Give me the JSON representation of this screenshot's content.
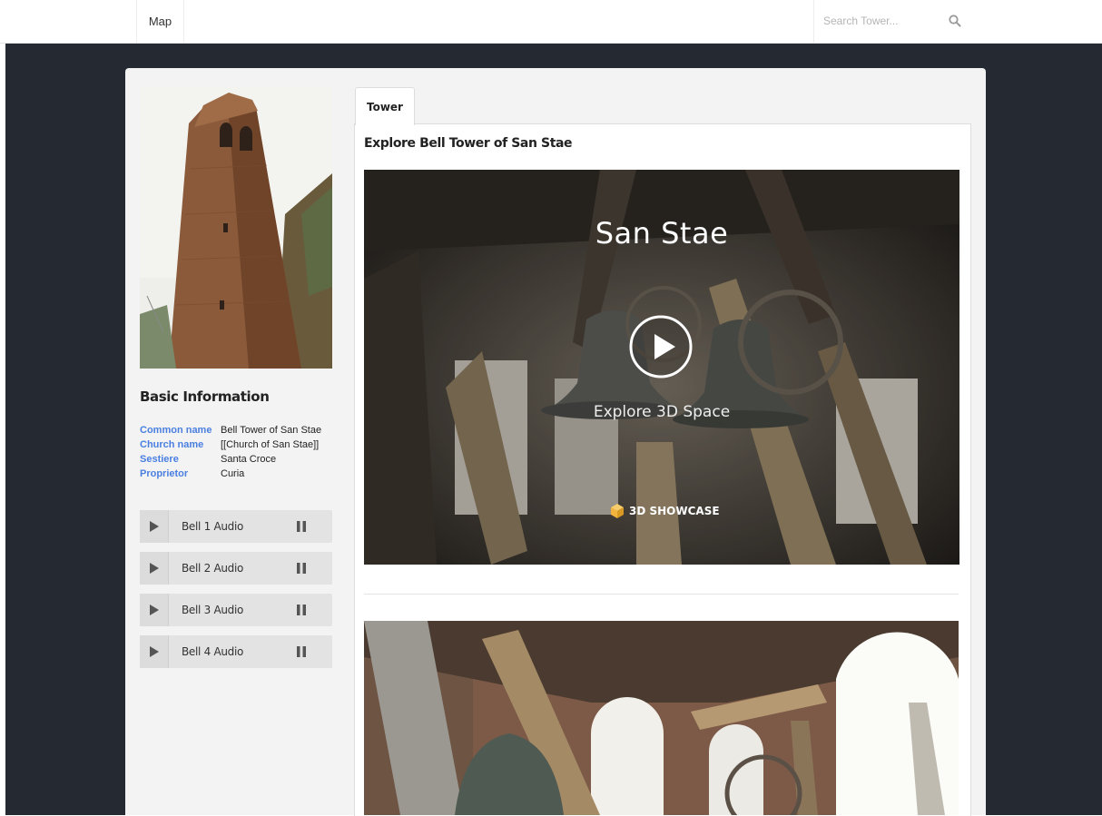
{
  "navbar": {
    "map_link": "Map",
    "search": {
      "placeholder": "Search Tower...",
      "icon": "search-icon"
    }
  },
  "sidebar": {
    "photo_icon": "tower-photo",
    "basic_info": {
      "heading": "Basic Information",
      "rows": [
        {
          "key": "Common name",
          "value": "Bell Tower of San Stae"
        },
        {
          "key": "Church name",
          "value": "[[Church of San Stae]]"
        },
        {
          "key": "Sestiere",
          "value": "Santa Croce"
        },
        {
          "key": "Proprietor",
          "value": "Curia"
        }
      ]
    },
    "audio_players": [
      {
        "label": "Bell 1 Audio"
      },
      {
        "label": "Bell 2 Audio"
      },
      {
        "label": "Bell 3 Audio"
      },
      {
        "label": "Bell 4 Audio"
      }
    ]
  },
  "main": {
    "tabs": [
      {
        "label": "Tower",
        "active": true
      }
    ],
    "explore_title": "Explore Bell Tower of San Stae",
    "viewer": {
      "title": "San Stae",
      "caption": "Explore 3D Space",
      "badge": "3D SHOWCASE",
      "play_icon": "play-icon"
    }
  },
  "colors": {
    "stage_bg": "#252931",
    "panel_bg": "#f3f3f3",
    "info_key": "#4a7fe0",
    "player_bg": "#e3e3e3",
    "showcase_cube": "#f2b43c"
  }
}
